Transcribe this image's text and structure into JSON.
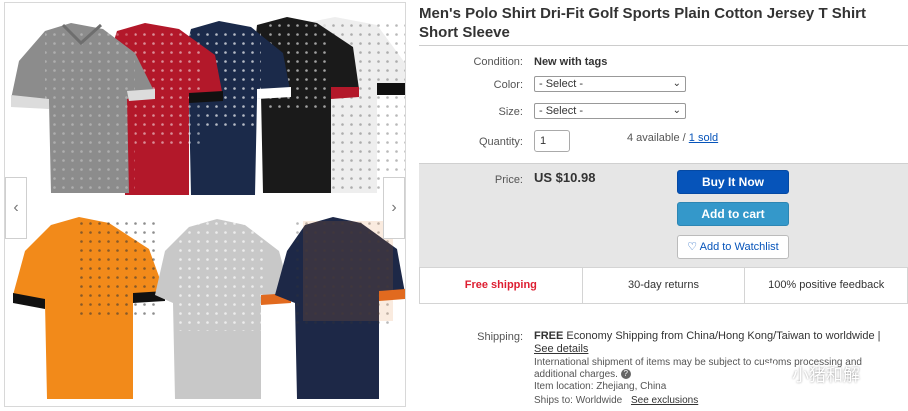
{
  "product": {
    "title": "Men's Polo Shirt Dri-Fit Golf Sports Plain Cotton Jersey T Shirt Short Sleeve"
  },
  "gallery": {
    "prev_icon": "chevron-left-icon",
    "next_icon": "chevron-right-icon",
    "shirt_colors": [
      "#8c8c8c",
      "#b3182a",
      "#1b2a4a",
      "#1a1a1a",
      "#eeeeee",
      "#f28a1a",
      "#c8c8c8",
      "#1d2847"
    ]
  },
  "details": {
    "condition_label": "Condition:",
    "condition_value": "New with tags",
    "color_label": "Color:",
    "color_select": "- Select -",
    "size_label": "Size:",
    "size_select": "- Select -",
    "quantity_label": "Quantity:",
    "quantity_value": "1",
    "available_text": "4 available /",
    "sold_link": "1 sold"
  },
  "purchase": {
    "price_label": "Price:",
    "price_value": "US $10.98",
    "buy_now": "Buy It Now",
    "add_to_cart": "Add to cart",
    "watchlist": "Add to Watchlist",
    "watch_icon": "heart-icon"
  },
  "strip": {
    "free_shipping": "Free shipping",
    "returns": "30-day returns",
    "feedback": "100% positive feedback"
  },
  "shipping": {
    "label": "Shipping:",
    "free": "FREE",
    "economy": "Economy Shipping from China/Hong Kong/Taiwan to worldwide |",
    "see_details": "See details",
    "intl_note": "International shipment of items may be subject to customs processing and additional charges.",
    "item_location": "Item location:  Zhejiang, China",
    "ships_to": "Ships to:  Worldwide",
    "see_exclusions": "See exclusions"
  },
  "watermark": {
    "text": "小猪和解",
    "icon": "wechat-icon"
  },
  "colors": {
    "buy_blue": "#0654ba",
    "cart_blue": "#3498ca",
    "free_red": "#dd1e31"
  }
}
